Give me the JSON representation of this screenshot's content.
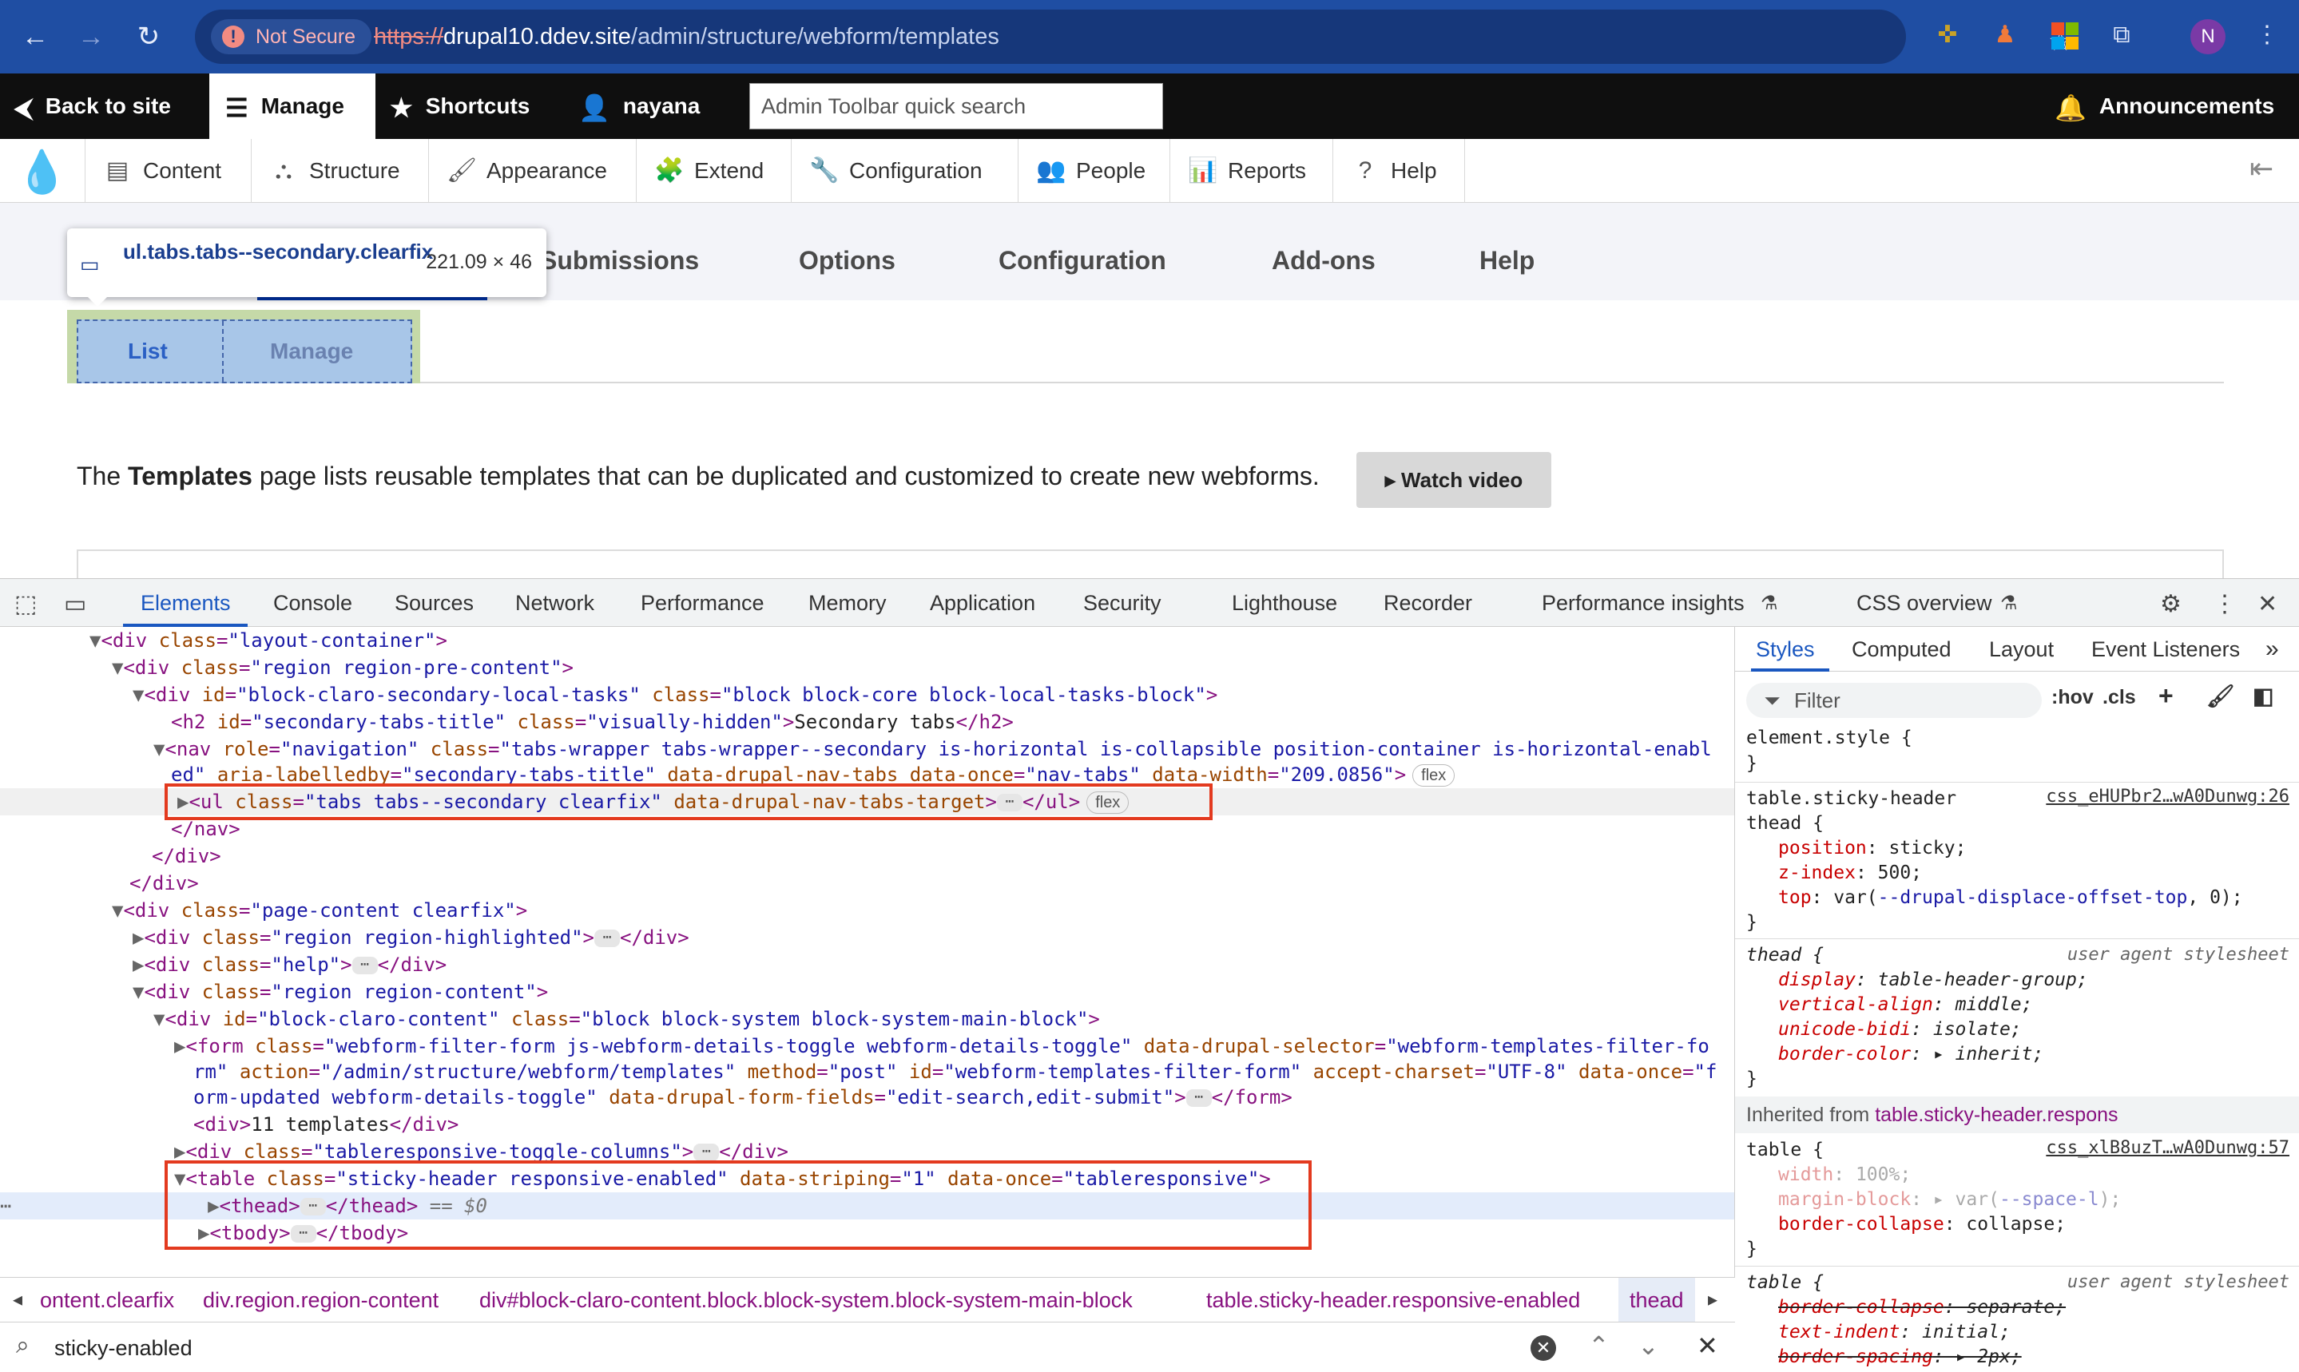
{
  "browser": {
    "not_secure": "Not Secure",
    "url_scheme": "https://",
    "url_host": "drupal10.ddev.site",
    "url_path": "/admin/structure/webform/templates",
    "profile_initial": "N"
  },
  "toolbar": {
    "back": "Back to site",
    "manage": "Manage",
    "shortcuts": "Shortcuts",
    "user": "nayana",
    "search_placeholder": "Admin Toolbar quick search",
    "announcements": "Announcements"
  },
  "admin_menu": {
    "items": [
      "Content",
      "Structure",
      "Appearance",
      "Extend",
      "Configuration",
      "People",
      "Reports",
      "Help"
    ]
  },
  "page": {
    "primary_tabs": [
      "Submissions",
      "Options",
      "Configuration",
      "Add-ons",
      "Help"
    ],
    "tooltip_selector": "ul.tabs.tabs--secondary.clearfix",
    "tooltip_size": "221.09 × 46",
    "secondary_tabs": [
      "List",
      "Manage"
    ],
    "intro_before": "The ",
    "intro_bold": "Templates",
    "intro_after": " page lists reusable templates that can be duplicated and customized to create new webforms.",
    "watch_video": "▸ Watch video"
  },
  "devtools": {
    "tabs": [
      "Elements",
      "Console",
      "Sources",
      "Network",
      "Performance",
      "Memory",
      "Application",
      "Security",
      "Lighthouse",
      "Recorder",
      "Performance insights",
      "CSS overview"
    ],
    "breadcrumbs": [
      "ontent.clearfix",
      "div.region.region-content",
      "div#block-claro-content.block.block-system.block-system-main-block",
      "table.sticky-header.responsive-enabled",
      "thead"
    ],
    "search_value": "sticky-enabled",
    "styles_tabs": [
      "Styles",
      "Computed",
      "Layout",
      "Event Listeners"
    ],
    "filter_placeholder": "Filter",
    "hov": ":hov",
    "cls": ".cls"
  }
}
